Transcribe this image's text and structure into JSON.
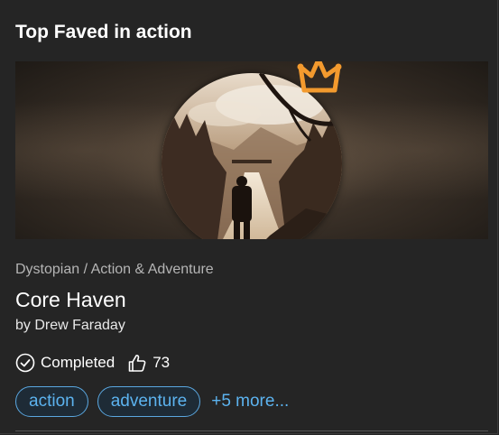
{
  "section": {
    "title": "Top Faved in action"
  },
  "book": {
    "genre": "Dystopian / Action & Adventure",
    "title": "Core Haven",
    "author": "by Drew Faraday",
    "status": "Completed",
    "likes": "73"
  },
  "tags": [
    {
      "label": "action"
    },
    {
      "label": "adventure"
    }
  ],
  "more_tags": "+5 more...",
  "icons": {
    "crown": "crown-icon",
    "status": "check-circle-icon",
    "likes": "thumbs-up-icon"
  },
  "colors": {
    "accent": "#5cb3ef",
    "crown": "#f39a2e",
    "background": "#252525"
  }
}
